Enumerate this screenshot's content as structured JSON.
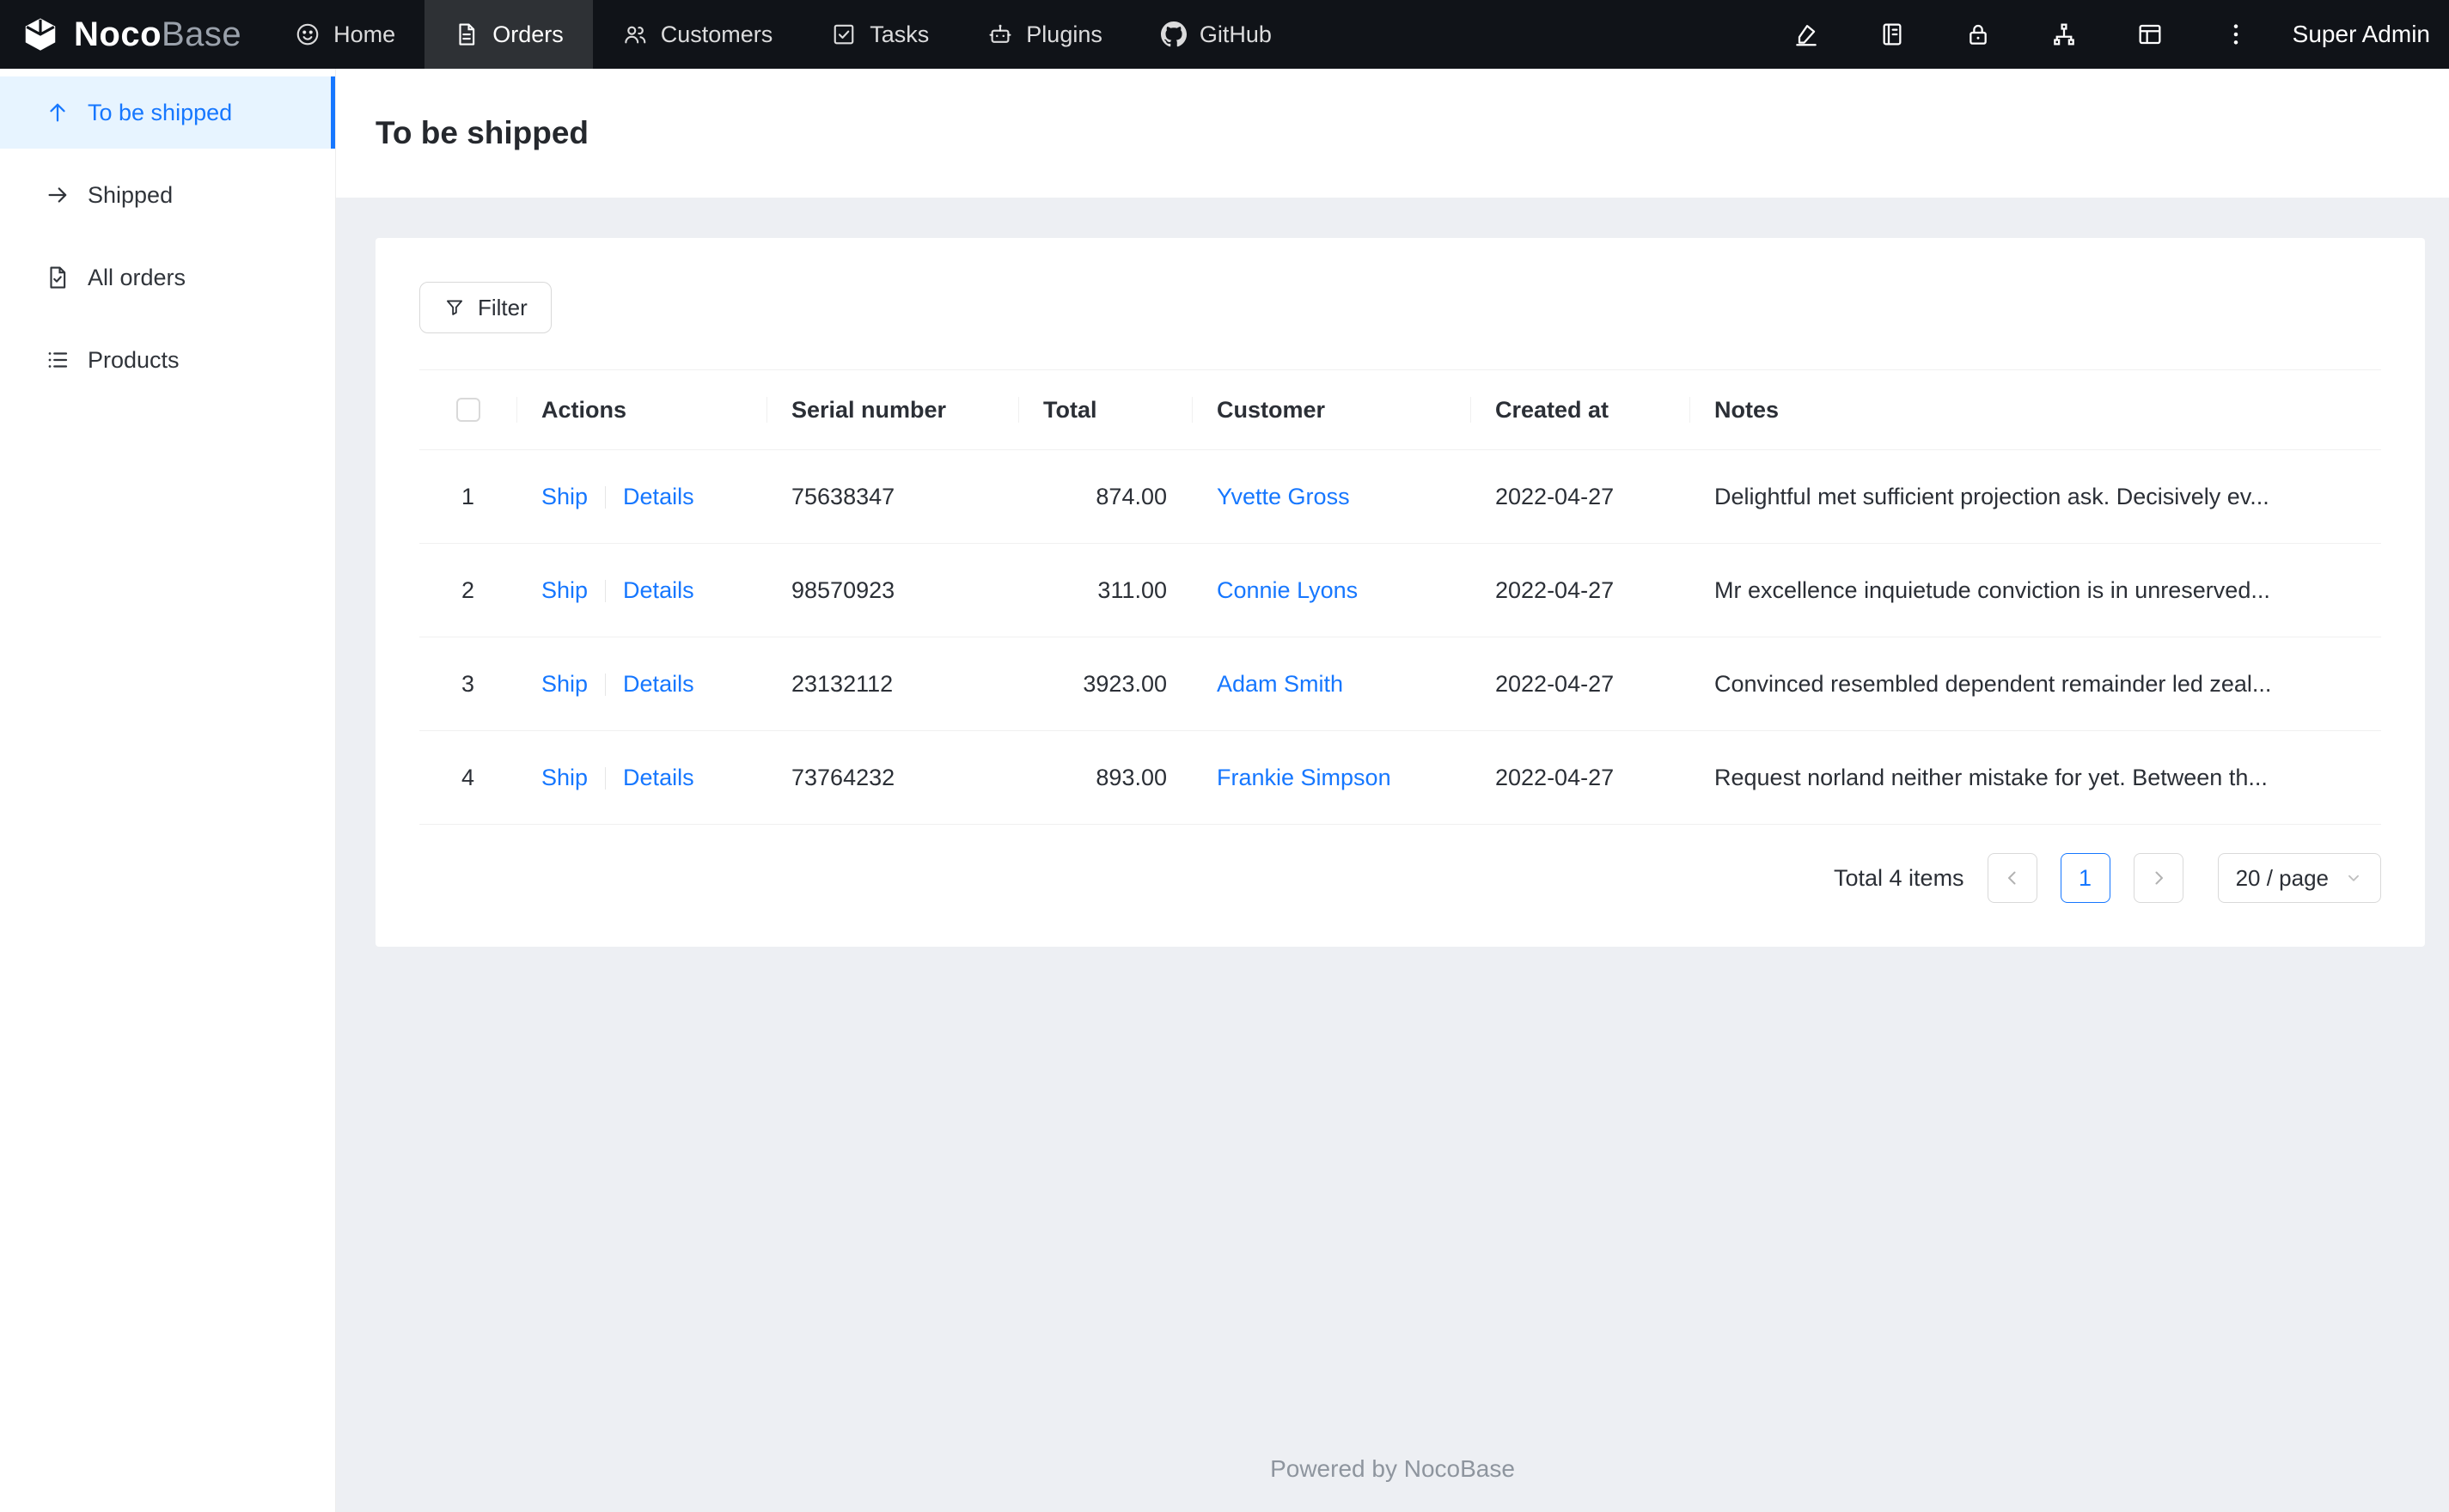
{
  "topbar": {
    "logo": {
      "noco": "Noco",
      "base": "Base"
    },
    "nav": [
      {
        "label": "Home"
      },
      {
        "label": "Orders"
      },
      {
        "label": "Customers"
      },
      {
        "label": "Tasks"
      },
      {
        "label": "Plugins"
      },
      {
        "label": "GitHub"
      }
    ],
    "right_icons": [
      "design-mode-icon",
      "collections-icon",
      "lock-icon",
      "api-icon",
      "layout-icon",
      "more-icon"
    ],
    "user": "Super Admin"
  },
  "sidebar": {
    "items": [
      {
        "label": "To be shipped",
        "icon": "arrow-up-icon",
        "active": true
      },
      {
        "label": "Shipped",
        "icon": "arrow-right-icon",
        "active": false
      },
      {
        "label": "All orders",
        "icon": "file-check-icon",
        "active": false
      },
      {
        "label": "Products",
        "icon": "list-icon",
        "active": false
      }
    ]
  },
  "page": {
    "title": "To be shipped"
  },
  "toolbar": {
    "filter_label": "Filter"
  },
  "table": {
    "columns": [
      "Actions",
      "Serial number",
      "Total",
      "Customer",
      "Created at",
      "Notes"
    ],
    "rows": [
      {
        "index": "1",
        "ship": "Ship",
        "details": "Details",
        "serial": "75638347",
        "total": "874.00",
        "customer": "Yvette Gross",
        "created_at": "2022-04-27",
        "notes": "Delightful met sufficient projection ask. Decisively ev..."
      },
      {
        "index": "2",
        "ship": "Ship",
        "details": "Details",
        "serial": "98570923",
        "total": "311.00",
        "customer": "Connie Lyons",
        "created_at": "2022-04-27",
        "notes": "Mr excellence inquietude conviction is in unreserved..."
      },
      {
        "index": "3",
        "ship": "Ship",
        "details": "Details",
        "serial": "23132112",
        "total": "3923.00",
        "customer": "Adam Smith",
        "created_at": "2022-04-27",
        "notes": "Convinced resembled dependent remainder led zeal..."
      },
      {
        "index": "4",
        "ship": "Ship",
        "details": "Details",
        "serial": "73764232",
        "total": "893.00",
        "customer": "Frankie Simpson",
        "created_at": "2022-04-27",
        "notes": "Request norland neither mistake for yet. Between th..."
      }
    ]
  },
  "pagination": {
    "total_text": "Total 4 items",
    "current_page": "1",
    "page_size": "20 / page"
  },
  "footer": {
    "text": "Powered by NocoBase"
  },
  "colors": {
    "accent": "#1677ff",
    "topbar_bg": "#101318",
    "sidebar_active_bg": "#e7f4ff",
    "link": "#1677ff",
    "page_bg": "#edeff3"
  }
}
